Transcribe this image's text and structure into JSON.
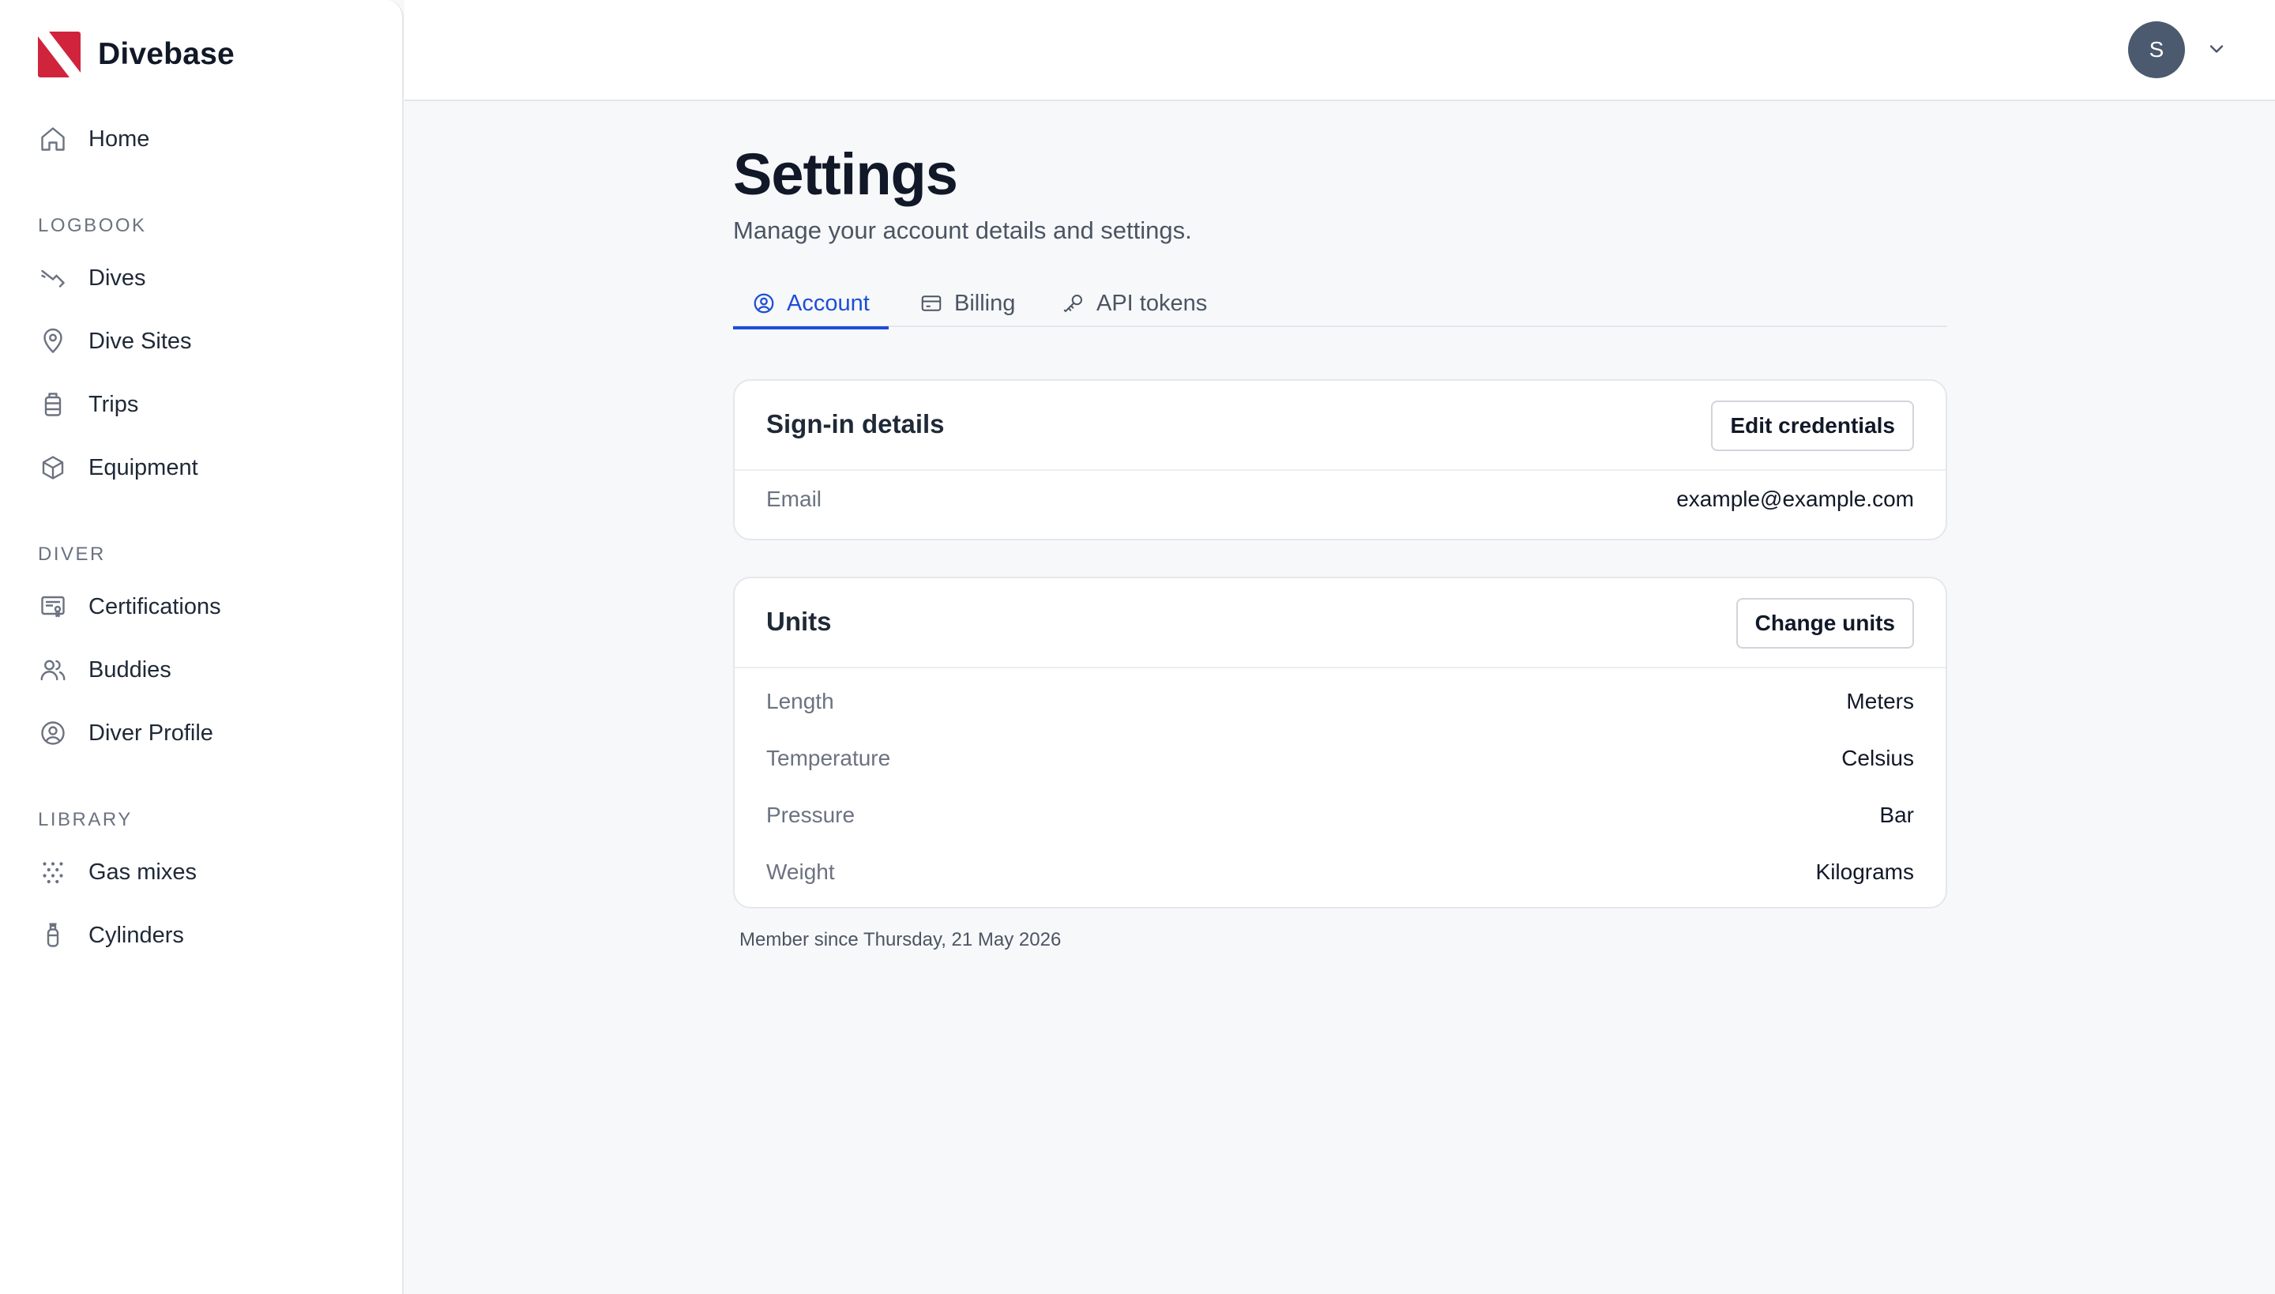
{
  "app": {
    "name": "Divebase",
    "brand_color": "#d0243d",
    "accent": "#1d4ed8"
  },
  "sidebar": {
    "home": {
      "label": "Home",
      "icon": "home-icon"
    },
    "sections": [
      {
        "title": "Logbook",
        "items": [
          {
            "label": "Dives",
            "icon": "dive-icon"
          },
          {
            "label": "Dive Sites",
            "icon": "map-pin-icon"
          },
          {
            "label": "Trips",
            "icon": "luggage-icon"
          },
          {
            "label": "Equipment",
            "icon": "box-icon"
          }
        ]
      },
      {
        "title": "Diver",
        "items": [
          {
            "label": "Certifications",
            "icon": "certificate-icon"
          },
          {
            "label": "Buddies",
            "icon": "users-icon"
          },
          {
            "label": "Diver Profile",
            "icon": "user-circle-icon"
          }
        ]
      },
      {
        "title": "Library",
        "items": [
          {
            "label": "Gas mixes",
            "icon": "dots-grid-icon"
          },
          {
            "label": "Cylinders",
            "icon": "cylinder-icon"
          }
        ]
      }
    ]
  },
  "user": {
    "initial": "S"
  },
  "page": {
    "title": "Settings",
    "subtitle": "Manage your account details and settings."
  },
  "tabs": [
    {
      "label": "Account",
      "icon": "user-circle-icon",
      "active": true
    },
    {
      "label": "Billing",
      "icon": "credit-card-icon",
      "active": false
    },
    {
      "label": "API tokens",
      "icon": "key-icon",
      "active": false
    }
  ],
  "signin": {
    "title": "Sign-in details",
    "button": "Edit credentials",
    "rows": [
      {
        "label": "Email",
        "value": "example@example.com"
      }
    ]
  },
  "units": {
    "title": "Units",
    "button": "Change units",
    "rows": [
      {
        "label": "Length",
        "value": "Meters"
      },
      {
        "label": "Temperature",
        "value": "Celsius"
      },
      {
        "label": "Pressure",
        "value": "Bar"
      },
      {
        "label": "Weight",
        "value": "Kilograms"
      }
    ]
  },
  "footer": {
    "member_since": "Member since Thursday, 21 May 2026"
  }
}
